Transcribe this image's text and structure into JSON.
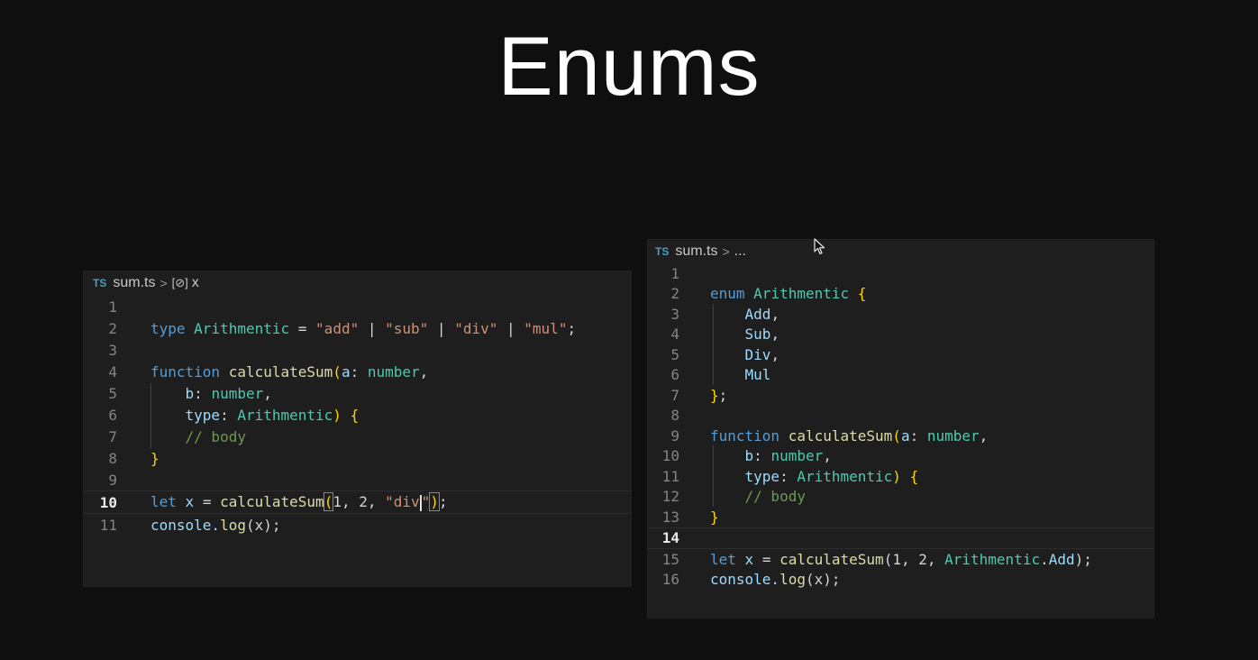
{
  "slide": {
    "title": "Enums"
  },
  "left_editor": {
    "breadcrumb": {
      "lang": "TS",
      "file": "sum.ts",
      "separator": ">",
      "symbol_icon": "[⊘]",
      "symbol": "x"
    },
    "line_numbers": [
      "1",
      "2",
      "3",
      "4",
      "5",
      "6",
      "7",
      "8",
      "9",
      "10",
      "11"
    ],
    "tokens": {
      "l2": [
        "type",
        "Arithmentic",
        " = ",
        "\"add\"",
        " | ",
        "\"sub\"",
        " | ",
        "\"div\"",
        " | ",
        "\"mul\"",
        ";"
      ],
      "l4": [
        "function",
        "calculateSum",
        "(",
        "a",
        ": ",
        "number",
        ","
      ],
      "l5": [
        "b",
        ": ",
        "number",
        ","
      ],
      "l6": [
        "type",
        ": ",
        "Arithmentic",
        ")",
        "{"
      ],
      "l7": [
        "// body"
      ],
      "l8": [
        "}"
      ],
      "l10": [
        "let",
        "x",
        " = ",
        "calculateSum",
        "(",
        "1, 2, ",
        "\"div",
        "\"",
        ")",
        ";"
      ],
      "l11": [
        "console.",
        "log",
        "(x);"
      ]
    }
  },
  "right_editor": {
    "breadcrumb": {
      "lang": "TS",
      "file": "sum.ts",
      "separator": ">",
      "more": "..."
    },
    "line_numbers": [
      "1",
      "2",
      "3",
      "4",
      "5",
      "6",
      "7",
      "8",
      "9",
      "10",
      "11",
      "12",
      "13",
      "14",
      "15",
      "16"
    ],
    "tokens": {
      "l2": [
        "enum",
        "Arithmentic",
        "{"
      ],
      "l3": [
        "Add",
        ","
      ],
      "l4": [
        "Sub",
        ","
      ],
      "l5": [
        "Div",
        ","
      ],
      "l6": [
        "Mul"
      ],
      "l7": [
        "}",
        ";"
      ],
      "l9": [
        "function",
        "calculateSum",
        "(",
        "a",
        ": ",
        "number",
        ","
      ],
      "l10": [
        "b",
        ": ",
        "number",
        ","
      ],
      "l11": [
        "type",
        ": ",
        "Arithmentic",
        ")",
        "{"
      ],
      "l12": [
        "// body"
      ],
      "l13": [
        "}"
      ],
      "l15": [
        "let",
        "x",
        " = ",
        "calculateSum",
        "(1, 2, ",
        "Arithmentic",
        ".",
        "Add",
        ");"
      ],
      "l16": [
        "console.",
        "log",
        "(x);"
      ]
    }
  },
  "colors": {
    "keyword": "#569cd6",
    "type": "#4ec9b0",
    "function": "#dcdcaa",
    "string": "#ce9178",
    "param": "#9cdcfe",
    "comment": "#6a9955",
    "bracket": "#ffd700"
  }
}
